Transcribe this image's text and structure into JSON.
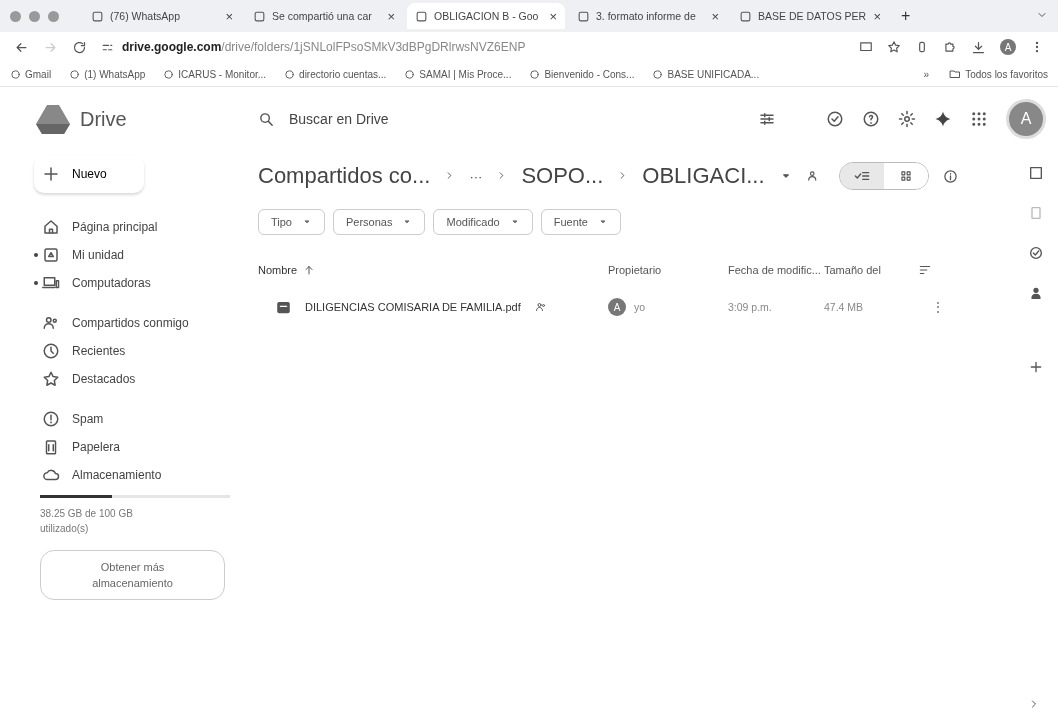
{
  "browser": {
    "tabs": [
      {
        "title": "(76) WhatsApp",
        "selected": false
      },
      {
        "title": "Se compartió una car",
        "selected": false
      },
      {
        "title": "OBLIGACION B - Goo",
        "selected": true
      },
      {
        "title": "3. formato informe de",
        "selected": false
      },
      {
        "title": "BASE DE DATOS PER",
        "selected": false
      }
    ],
    "close_glyph": "×",
    "new_tab_glyph": "+",
    "url_domain": "drive.google.com",
    "url_path": "/drive/folders/1jSNLolFPsoSMkV3dBPgDRlrwsNVZ6ENP",
    "bookmarks": [
      "Gmail",
      "(1) WhatsApp",
      "ICARUS - Monitor...",
      "directorio cuentas...",
      "SAMAI | Mis Proce...",
      "Bienvenido - Cons...",
      "BASE UNIFICADA..."
    ],
    "profile_avatar": "A",
    "more_bookmarks": "»",
    "all_bookmarks": "Todos los favoritos"
  },
  "app": {
    "name": "Drive",
    "search": {
      "placeholder": "Buscar en Drive"
    },
    "avatar": "A"
  },
  "sidebar": {
    "new_button": "Nuevo",
    "groups": [
      [
        {
          "label": "Página principal",
          "expandable": false
        },
        {
          "label": "Mi unidad",
          "expandable": true
        },
        {
          "label": "Computadoras",
          "expandable": true
        }
      ],
      [
        {
          "label": "Compartidos conmigo",
          "expandable": false
        },
        {
          "label": "Recientes",
          "expandable": false
        },
        {
          "label": "Destacados",
          "expandable": false
        }
      ],
      [
        {
          "label": "Spam",
          "expandable": false
        },
        {
          "label": "Papelera",
          "expandable": false
        },
        {
          "label": "Almacenamiento",
          "expandable": false
        }
      ]
    ],
    "storage": {
      "level": 0.38,
      "text": "38.25 GB de 100 GB utilizado(s)",
      "button": "Obtener más almacenamiento"
    }
  },
  "breadcrumb": [
    "Compartidos co...",
    "···",
    "SOPO...",
    "OBLIGACI..."
  ],
  "view_toggle": [
    {
      "selected": true
    },
    {
      "selected": false
    }
  ],
  "filters": [
    "Tipo",
    "Personas",
    "Modificado",
    "Fuente"
  ],
  "table": {
    "columns": [
      "Nombre",
      "Propietario",
      "Fecha de modific...",
      "Tamaño del"
    ],
    "rows": [
      {
        "name": "DILIGENCIAS COMISARIA DE FAMILIA.pdf",
        "shared": true,
        "owner_avatar": "A",
        "owner": "yo",
        "modified": "3:09 p.m.",
        "size": "47.4 MB",
        "more": "⋮"
      }
    ]
  }
}
